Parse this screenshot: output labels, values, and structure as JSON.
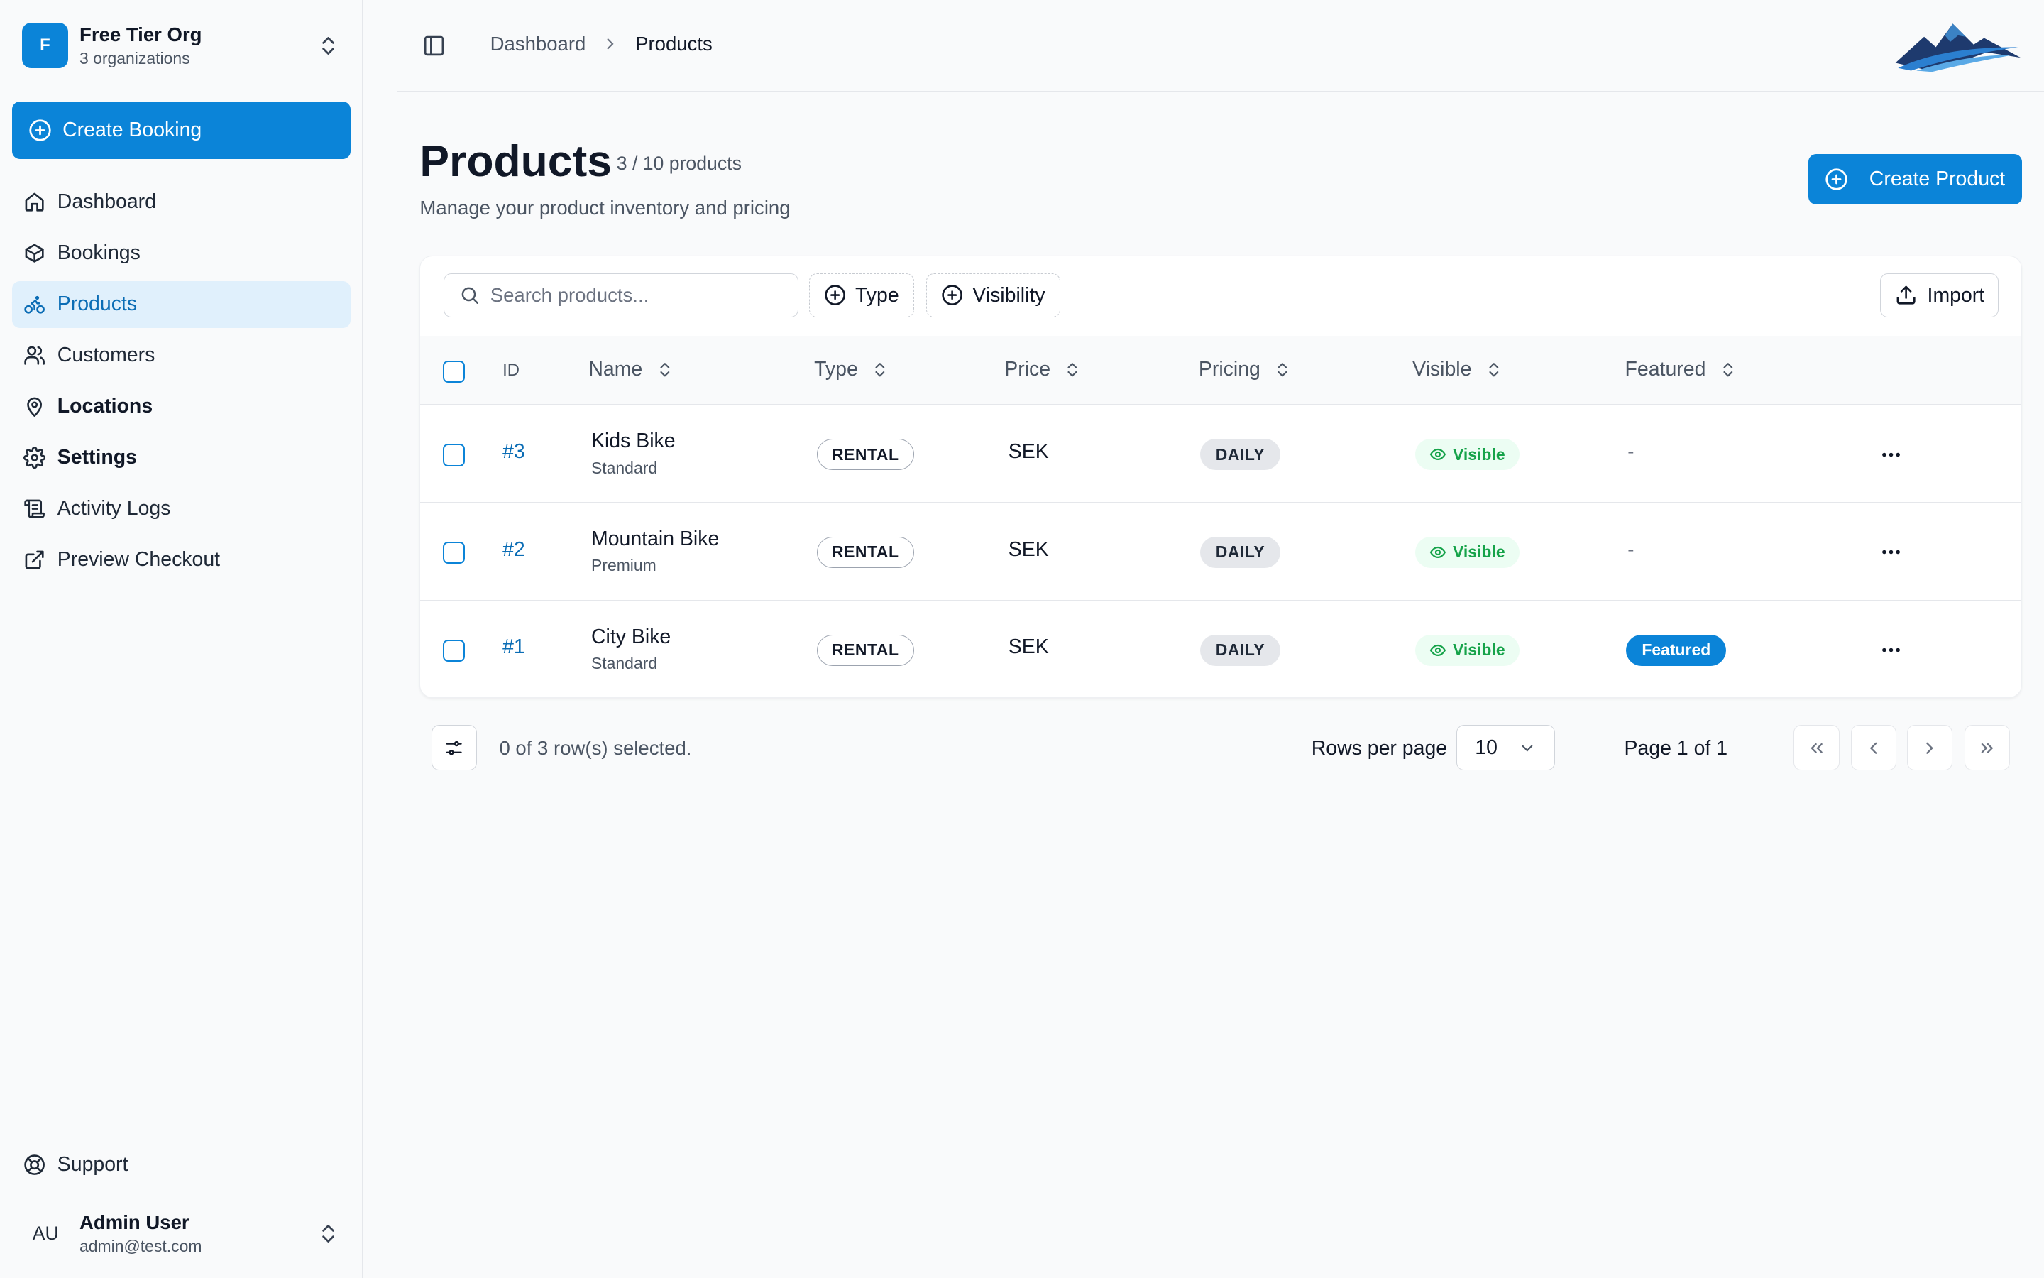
{
  "org": {
    "avatar_letter": "F",
    "name": "Free Tier Org",
    "subtitle": "3 organizations"
  },
  "sidebar": {
    "create_booking": "Create Booking",
    "items": [
      {
        "label": "Dashboard",
        "icon": "home-icon"
      },
      {
        "label": "Bookings",
        "icon": "box-icon"
      },
      {
        "label": "Products",
        "icon": "bike-icon",
        "active": true
      },
      {
        "label": "Customers",
        "icon": "users-icon"
      },
      {
        "label": "Locations",
        "icon": "map-pin-icon"
      },
      {
        "label": "Settings",
        "icon": "gear-icon"
      },
      {
        "label": "Activity Logs",
        "icon": "scroll-icon"
      },
      {
        "label": "Preview Checkout",
        "icon": "external-link-icon"
      }
    ],
    "support": "Support"
  },
  "user": {
    "initials": "AU",
    "name": "Admin User",
    "email": "admin@test.com"
  },
  "breadcrumb": {
    "parent": "Dashboard",
    "current": "Products"
  },
  "page": {
    "title": "Products",
    "count": "3 / 10 products",
    "subtitle": "Manage your product inventory and pricing",
    "create_button": "Create Product"
  },
  "toolbar": {
    "search_placeholder": "Search products...",
    "filter_type": "Type",
    "filter_visibility": "Visibility",
    "import": "Import"
  },
  "table": {
    "columns": {
      "id": "ID",
      "name": "Name",
      "type": "Type",
      "price": "Price",
      "pricing": "Pricing",
      "visible": "Visible",
      "featured": "Featured"
    },
    "rows": [
      {
        "id": "#3",
        "name": "Kids Bike",
        "tier": "Standard",
        "type": "RENTAL",
        "price": "SEK",
        "pricing": "DAILY",
        "visible": "Visible",
        "featured": "-"
      },
      {
        "id": "#2",
        "name": "Mountain Bike",
        "tier": "Premium",
        "type": "RENTAL",
        "price": "SEK",
        "pricing": "DAILY",
        "visible": "Visible",
        "featured": "-"
      },
      {
        "id": "#1",
        "name": "City Bike",
        "tier": "Standard",
        "type": "RENTAL",
        "price": "SEK",
        "pricing": "DAILY",
        "visible": "Visible",
        "featured": "Featured"
      }
    ]
  },
  "footer": {
    "selected": "0 of 3 row(s) selected.",
    "rows_per_page_label": "Rows per page",
    "rows_per_page_value": "10",
    "page_label": "Page 1 of 1"
  },
  "colors": {
    "accent": "#0b84d8",
    "visible_green": "#16a34a",
    "active_nav_bg": "#e0f0fc"
  }
}
